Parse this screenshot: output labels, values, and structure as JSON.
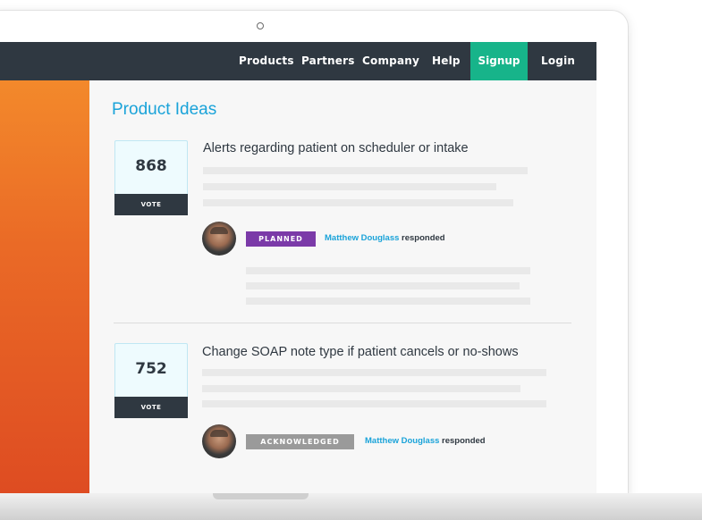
{
  "nav": {
    "items": [
      "Products",
      "Partners",
      "Company",
      "Help"
    ],
    "signup": "Signup",
    "login": "Login"
  },
  "page_title": "Product Ideas",
  "ideas": [
    {
      "votes": "868",
      "vote_label": "VOTE",
      "title": "Alerts regarding patient on scheduler or intake",
      "status": "PLANNED",
      "responder": "Matthew Douglass",
      "responded": "responded"
    },
    {
      "votes": "752",
      "vote_label": "VOTE",
      "title": "Change SOAP note type if patient cancels or no-shows",
      "status": "ACKNOWLEDGED",
      "responder": "Matthew Douglass",
      "responded": "responded"
    }
  ],
  "colors": {
    "navbar": "#2f3841",
    "signup": "#17b48a",
    "title": "#1aa3d9",
    "planned": "#7b3aa8",
    "acknowledged": "#9a9a9a"
  }
}
